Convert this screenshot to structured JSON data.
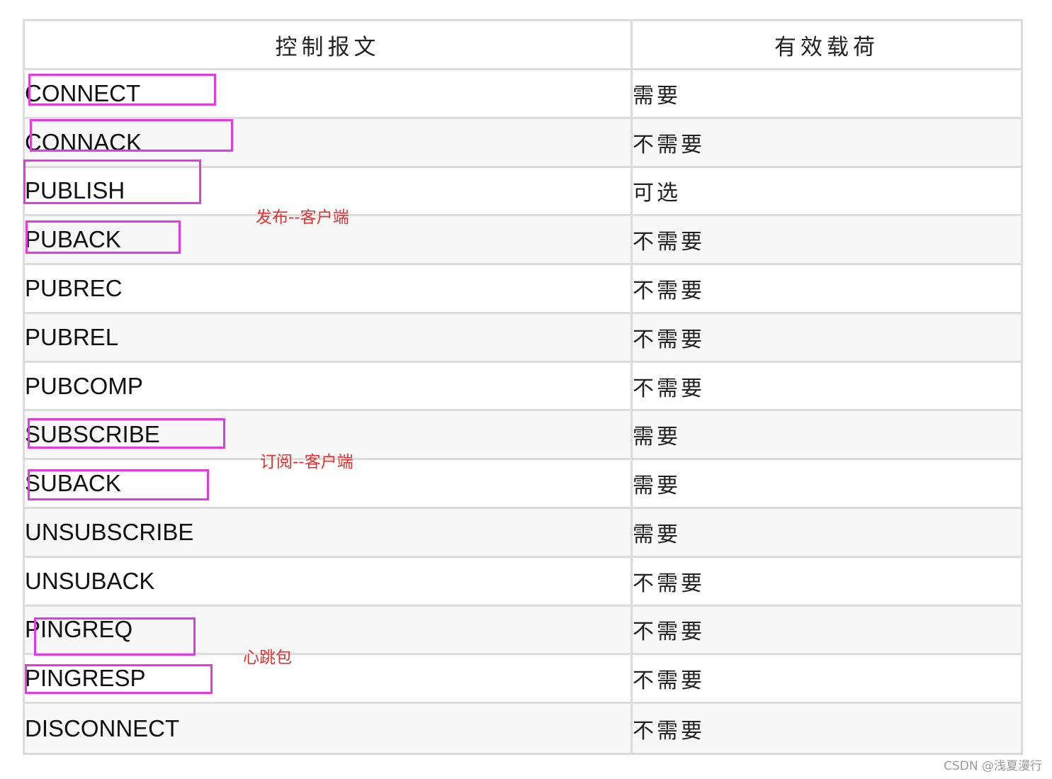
{
  "table": {
    "headers": [
      "控制报文",
      "有效载荷"
    ],
    "rows": [
      {
        "message": "CONNECT",
        "payload": "需要"
      },
      {
        "message": "CONNACK",
        "payload": "不需要"
      },
      {
        "message": "PUBLISH",
        "payload": "可选"
      },
      {
        "message": "PUBACK",
        "payload": "不需要"
      },
      {
        "message": "PUBREC",
        "payload": "不需要"
      },
      {
        "message": "PUBREL",
        "payload": "不需要"
      },
      {
        "message": "PUBCOMP",
        "payload": "不需要"
      },
      {
        "message": "SUBSCRIBE",
        "payload": "需要"
      },
      {
        "message": "SUBACK",
        "payload": "需要"
      },
      {
        "message": "UNSUBSCRIBE",
        "payload": "需要"
      },
      {
        "message": "UNSUBACK",
        "payload": "不需要"
      },
      {
        "message": "PINGREQ",
        "payload": "不需要"
      },
      {
        "message": "PINGRESP",
        "payload": "不需要"
      },
      {
        "message": "DISCONNECT",
        "payload": "不需要"
      }
    ]
  },
  "annotations": {
    "publish_note": "发布--客户端",
    "subscribe_note": "订阅--客户端",
    "heartbeat_note": "心跳包",
    "highlight_color": "#e23be3",
    "note_color": "#e8312f"
  },
  "watermark": "CSDN @浅夏漫行"
}
